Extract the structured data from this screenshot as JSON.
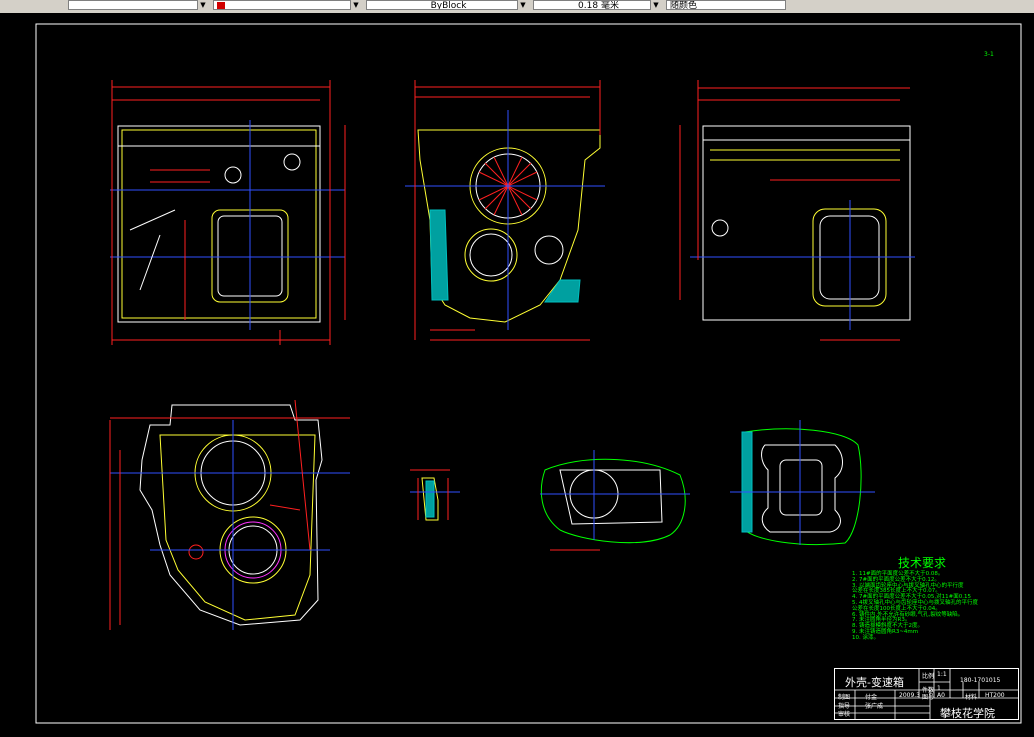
{
  "toolbar": {
    "layer_value": "",
    "color_value": "",
    "linetype_value": "ByBlock",
    "lineweight_value": "0.18 毫米",
    "plotstyle_value": "随颜色"
  },
  "drawing": {
    "page_note": "3-1",
    "tech_requirements": {
      "title": "技术要求",
      "items": [
        "1. 11#面的平面度公差不大于0.08。",
        "2. 7#面的平面度公差不大于0.12。",
        "3. 以端面齿轮座中心与拨叉轴孔中心的平行度",
        "   公差在长度385长度上不大于0.07。",
        "4. 7#面的平面度公差不大于0.05,对11#面0.15",
        "5. 4拨叉轴孔中心与齿轮座中心与拨叉轴孔的平行度",
        "   公差在长度100长度上不大于0.04。",
        "6. 铸件内,外不允许有砂眼,气孔,裂纹等缺陷。",
        "7. 未注圆角半径为R3。",
        "8. 铸造拔模斜度不大于2度。",
        "9. 未注铸造圆角R3~4mm",
        "10. 涂漆。"
      ]
    },
    "title_block": {
      "part_name": "外壳-变速箱",
      "scale_label": "比例",
      "scale_value": "1:1",
      "sheet_label": "件数",
      "sheet_value": "1",
      "drawing_no": "180-1701015",
      "designer_label": "制图",
      "designer_name": "付金",
      "date": "2009.3",
      "material_label": "图号",
      "material_value": "A0",
      "class_label": "材料",
      "class_value": "HT200",
      "checker_label": "指导",
      "checker_name": "张广成",
      "reviewer_label": "审核",
      "school": "攀枝花学院"
    }
  }
}
